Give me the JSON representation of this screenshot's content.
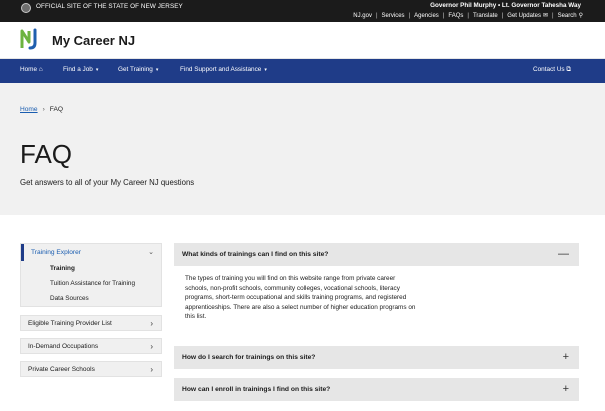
{
  "state_bar": {
    "official_text": "OFFICIAL SITE OF THE STATE OF NEW JERSEY",
    "governor_text": "Governor Phil Murphy • Lt. Governor Tahesha Way",
    "links": [
      "NJ.gov",
      "Services",
      "Agencies",
      "FAQs",
      "Translate",
      "Get Updates",
      "Search"
    ]
  },
  "brand": {
    "name": "My Career NJ",
    "logo_letters": "NJ"
  },
  "nav": {
    "items": [
      {
        "label": "Home"
      },
      {
        "label": "Find a Job"
      },
      {
        "label": "Get Training"
      },
      {
        "label": "Find Support and Assistance"
      }
    ],
    "contact": "Contact Us"
  },
  "breadcrumb": {
    "home": "Home",
    "current": "FAQ"
  },
  "page": {
    "title": "FAQ",
    "subtitle": "Get answers to all of your My Career NJ questions"
  },
  "sidebar": {
    "group": {
      "label": "Training Explorer",
      "items": [
        "Training",
        "Tuition Assistance for Training",
        "Data Sources"
      ]
    },
    "items": [
      "Eligible Training Provider List",
      "In-Demand Occupations",
      "Private Career Schools"
    ]
  },
  "faq": [
    {
      "question": "What kinds of trainings can I find on this site?",
      "expanded": true,
      "answer": "The types of training you will find on this website range from private career schools, non-profit schools, community colleges, vocational schools, literacy programs, short-term occupational and skills training programs, and registered apprenticeships. There are also a select number of higher education programs on this list."
    },
    {
      "question": "How do I search for trainings on this site?",
      "expanded": false
    },
    {
      "question": "How can I enroll in trainings I find on this site?",
      "expanded": false
    }
  ],
  "icons": {
    "home": "home-icon",
    "external": "external-link-icon",
    "mail": "mail-icon",
    "search": "search-icon",
    "collapse": "minus-icon",
    "expand": "plus-icon"
  },
  "colors": {
    "nav_blue": "#1f3c88",
    "link_blue": "#1a5db0",
    "state_bar": "#1b1b1b",
    "hero_bg": "#f1f1f1",
    "accordion_bg": "#e6e6e6",
    "logo_green": "#6cb33f",
    "logo_blue": "#1f5fae"
  }
}
